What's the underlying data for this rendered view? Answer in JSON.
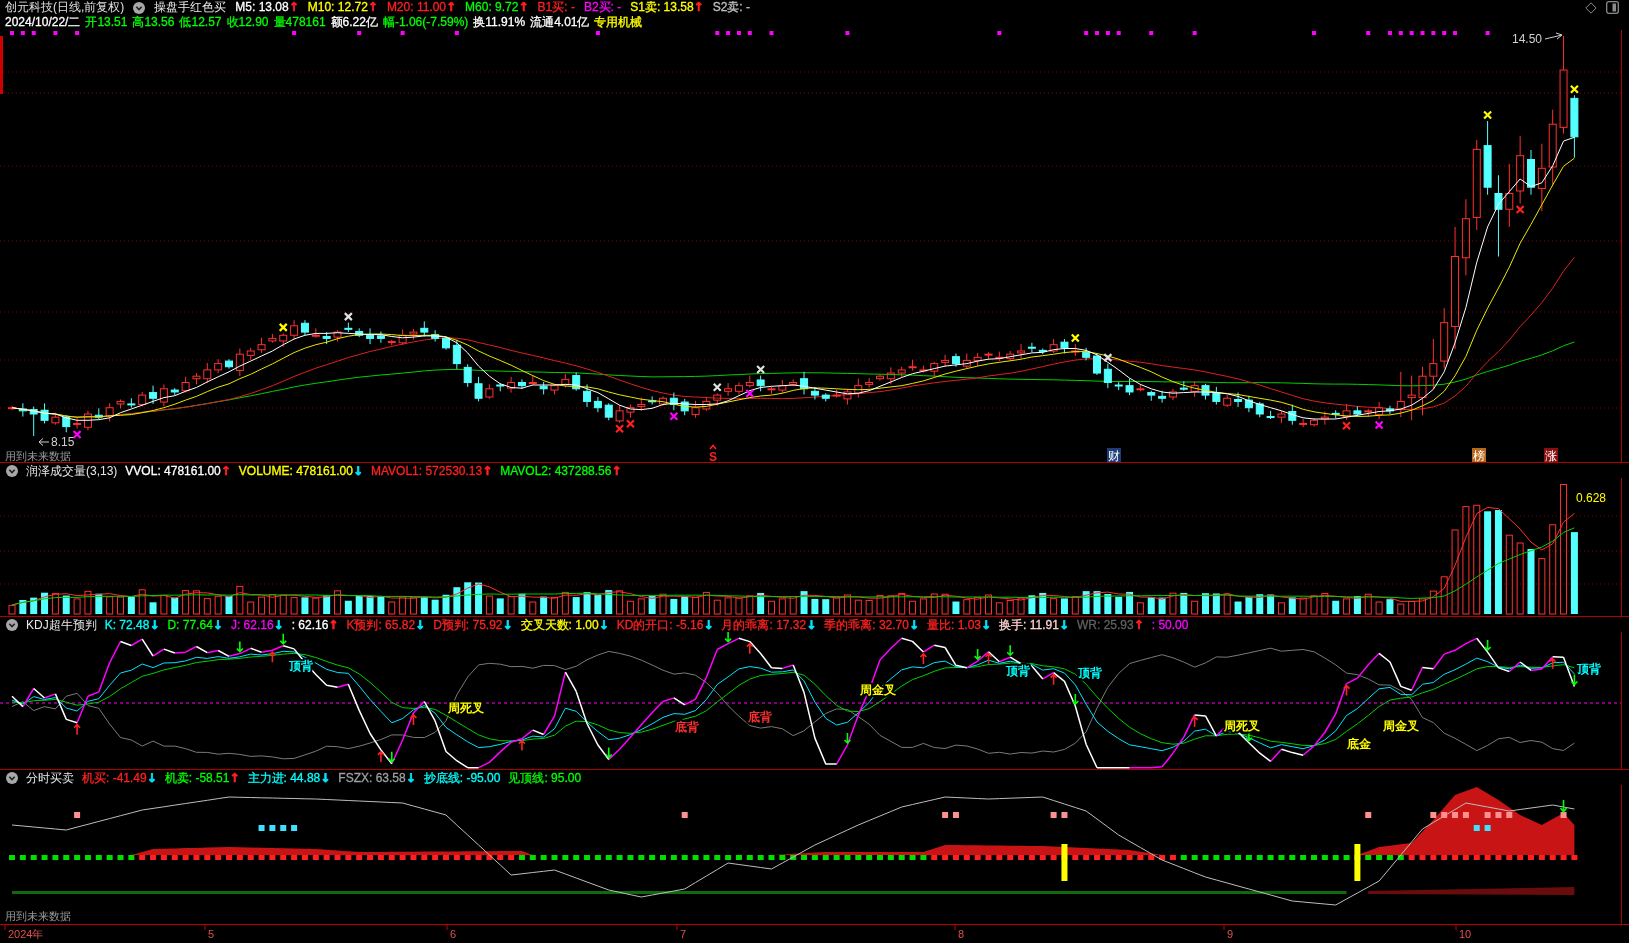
{
  "header": {
    "stock_name": "创元科技(日线,前复权)",
    "indicator_name": "操盘手红色买",
    "values": [
      {
        "label": "M5: 13.08",
        "color": "#ffffff",
        "arrow": {
          "text": "↑",
          "color": "#ff2020"
        }
      },
      {
        "label": "M10: 12.72",
        "color": "#ffff00",
        "arrow": {
          "text": "↑",
          "color": "#ff2020"
        }
      },
      {
        "label": "M20: 11.00",
        "color": "#ff2020",
        "arrow": {
          "text": "↑",
          "color": "#ff2020"
        }
      },
      {
        "label": "M60: 9.72",
        "color": "#00ff00",
        "arrow": {
          "text": "↑",
          "color": "#ff2020"
        }
      },
      {
        "label": "B1买: -",
        "color": "#ff2020"
      },
      {
        "label": "B2买: -",
        "color": "#ff00ff"
      },
      {
        "label": "S1卖: 13.58",
        "color": "#ffff00",
        "arrow": {
          "text": "↑",
          "color": "#ff2020"
        }
      },
      {
        "label": "S2卖: -",
        "color": "#c0c0c0"
      }
    ]
  },
  "quote": [
    {
      "text": "2024/10/22/二",
      "color": "#ffffff"
    },
    {
      "text": "开13.51",
      "color": "#00ff00"
    },
    {
      "text": "高13.56",
      "color": "#00ff00"
    },
    {
      "text": "低12.57",
      "color": "#00ff00"
    },
    {
      "text": "收12.90",
      "color": "#00ff00"
    },
    {
      "text": "量478161",
      "color": "#00ff00"
    },
    {
      "text": "额6.22亿",
      "color": "#ffffff"
    },
    {
      "text": "幅-1.06(-7.59%)",
      "color": "#00ff00"
    },
    {
      "text": "换11.91%",
      "color": "#ffffff"
    },
    {
      "text": "流通4.01亿",
      "color": "#ffffff"
    },
    {
      "text": "专用机械",
      "color": "#ffff00"
    }
  ],
  "price_panel": {
    "high_label": "14.50",
    "low_label": "8.15",
    "note": "用到未来数据",
    "event_markers": [
      {
        "text": "S",
        "kind": "arrow",
        "color": "#ff2020"
      },
      {
        "text": "财",
        "kind": "tile",
        "color": "#1e3c78"
      },
      {
        "text": "榜",
        "kind": "tile",
        "color": "#b8681a"
      },
      {
        "text": "涨",
        "kind": "tile",
        "color": "#8a1010"
      }
    ]
  },
  "volume_panel": {
    "title": "润泽成交量(3,13)",
    "values": [
      {
        "label": "VVOL: 478161.00",
        "color": "#ffffff",
        "arrow": {
          "text": "↑",
          "color": "#ff2020"
        }
      },
      {
        "label": "VOLUME: 478161.00",
        "color": "#ffff00",
        "arrow": {
          "text": "↓",
          "color": "#00e5ff"
        }
      },
      {
        "label": "MAVOL1: 572530.13",
        "color": "#ff2020",
        "arrow": {
          "text": "↑",
          "color": "#ff2020"
        }
      },
      {
        "label": "MAVOL2: 437288.56",
        "color": "#00ff00",
        "arrow": {
          "text": "↑",
          "color": "#ff2020"
        }
      }
    ],
    "peak_label": "0.628"
  },
  "kdj_panel": {
    "title": "KDJ超牛预判",
    "values": [
      {
        "label": "K: 72.48",
        "color": "#00ffff",
        "arrow": {
          "text": "↓",
          "color": "#00e5ff"
        }
      },
      {
        "label": "D: 77.64",
        "color": "#00ff00",
        "arrow": {
          "text": "↓",
          "color": "#00e5ff"
        }
      },
      {
        "label": "J: 62.16",
        "color": "#ff00ff",
        "arrow": {
          "text": "↓",
          "color": "#00e5ff"
        }
      },
      {
        "label": ": 62.16",
        "color": "#ffffff",
        "arrow": {
          "text": "↑",
          "color": "#ff2020"
        }
      },
      {
        "label": "K预判: 65.82",
        "color": "#ff2020",
        "arrow": {
          "text": "↓",
          "color": "#00e5ff"
        }
      },
      {
        "label": "D预判: 75.92",
        "color": "#ff2020",
        "arrow": {
          "text": "↓",
          "color": "#00e5ff"
        }
      },
      {
        "label": "交叉天数: 1.00",
        "color": "#ffff00",
        "arrow": {
          "text": "↓",
          "color": "#00e5ff"
        }
      },
      {
        "label": "KD的开口: -5.16",
        "color": "#ff2020",
        "arrow": {
          "text": "↓",
          "color": "#00e5ff"
        }
      },
      {
        "label": "月的乖离: 17.32",
        "color": "#ff2020",
        "arrow": {
          "text": "↓",
          "color": "#00e5ff"
        }
      },
      {
        "label": "季的乖离: 32.70",
        "color": "#ff2020",
        "arrow": {
          "text": "↓",
          "color": "#00e5ff"
        }
      },
      {
        "label": "量比: 1.03",
        "color": "#ff2020",
        "arrow": {
          "text": "↓",
          "color": "#00e5ff"
        }
      },
      {
        "label": "换手: 11.91",
        "color": "#ffd0d0",
        "arrow": {
          "text": "↓",
          "color": "#00e5ff"
        }
      },
      {
        "label": "WR: 25.93",
        "color": "#606060",
        "arrow": {
          "text": "↑",
          "color": "#ff2020"
        }
      },
      {
        "label": ": 50.00",
        "color": "#ff00ff"
      }
    ],
    "signals": [
      {
        "text": "顶背",
        "color": "#00ffff"
      },
      {
        "text": "周死叉",
        "color": "#ffff00"
      },
      {
        "text": "底背",
        "color": "#ff3030"
      },
      {
        "text": "底背",
        "color": "#ff3030"
      },
      {
        "text": "周金叉",
        "color": "#ffff00"
      },
      {
        "text": "顶背",
        "color": "#00ffff"
      },
      {
        "text": "顶背",
        "color": "#00ffff"
      },
      {
        "text": "周死叉",
        "color": "#ffff00"
      },
      {
        "text": "底金",
        "color": "#ffff00"
      },
      {
        "text": "周金叉",
        "color": "#ffff00"
      },
      {
        "text": "顶背",
        "color": "#00ffff"
      }
    ]
  },
  "trade_panel": {
    "title": "分时买卖",
    "values": [
      {
        "label": "机买: -41.49",
        "color": "#ff2020",
        "arrow": {
          "text": "↓",
          "color": "#00e5ff"
        }
      },
      {
        "label": "机卖: -58.51",
        "color": "#00ff00",
        "arrow": {
          "text": "↑",
          "color": "#ff2020"
        }
      },
      {
        "label": "主力进: 44.88",
        "color": "#00ffff",
        "arrow": {
          "text": "↓",
          "color": "#00e5ff"
        }
      },
      {
        "label": "FSZX: 63.58",
        "color": "#a0a0a0",
        "arrow": {
          "text": "↓",
          "color": "#00e5ff"
        }
      },
      {
        "label": "抄底线: -95.00",
        "color": "#00ffff"
      },
      {
        "label": "见顶线: 95.00",
        "color": "#00ff00"
      }
    ],
    "note": "用到未来数据"
  },
  "time_axis": [
    "2024年",
    "5",
    "6",
    "7",
    "8",
    "9",
    "10"
  ]
}
